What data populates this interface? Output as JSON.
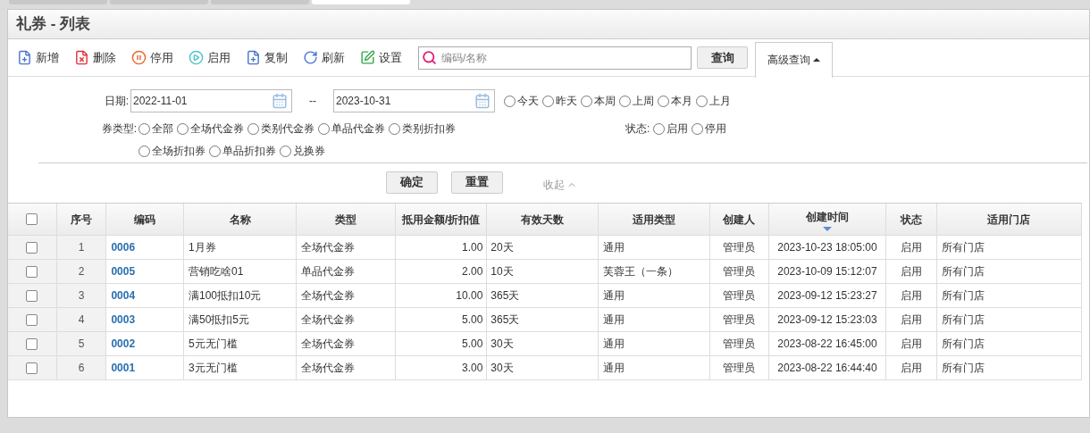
{
  "top_tabs": [
    {
      "selected": false
    },
    {
      "selected": false
    },
    {
      "selected": false
    },
    {
      "selected": true
    }
  ],
  "window": {
    "title": "礼券 - 列表"
  },
  "toolbar": [
    {
      "kind": "add",
      "label": "新增"
    },
    {
      "kind": "delete",
      "label": "删除"
    },
    {
      "kind": "pause",
      "label": "停用"
    },
    {
      "kind": "play",
      "label": "启用"
    },
    {
      "kind": "copy",
      "label": "复制"
    },
    {
      "kind": "refresh",
      "label": "刷新"
    },
    {
      "kind": "settings",
      "label": "设置"
    }
  ],
  "search": {
    "placeholder": "编码/名称",
    "button": "查询"
  },
  "advanced": {
    "label": "高级查询",
    "expanded": true
  },
  "filters": {
    "date_label": "日期:",
    "date_from": "2022-11-01",
    "date_sep": "--",
    "date_to": "2023-10-31",
    "date_presets": [
      {
        "label": "今天",
        "selected": false
      },
      {
        "label": "昨天",
        "selected": false
      },
      {
        "label": "本周",
        "selected": false
      },
      {
        "label": "上周",
        "selected": false
      },
      {
        "label": "本月",
        "selected": false
      },
      {
        "label": "上月",
        "selected": false
      }
    ],
    "type_label": "券类型:",
    "types": [
      {
        "label": "全部",
        "selected": false
      },
      {
        "label": "全场代金券",
        "selected": false
      },
      {
        "label": "类别代金券",
        "selected": false
      },
      {
        "label": "单品代金券",
        "selected": false
      },
      {
        "label": "类别折扣券",
        "selected": false
      },
      {
        "label": "全场折扣券",
        "selected": false
      },
      {
        "label": "单品折扣券",
        "selected": false
      },
      {
        "label": "兑换券",
        "selected": false
      }
    ],
    "status_label": "状态:",
    "statuses": [
      {
        "label": "启用",
        "selected": false
      },
      {
        "label": "停用",
        "selected": false
      }
    ],
    "confirm": "确定",
    "reset": "重置",
    "collapse": "收起"
  },
  "table": {
    "all_checked": false,
    "columns": [
      {
        "label": "序号",
        "sorted": false
      },
      {
        "label": "编码",
        "sorted": false
      },
      {
        "label": "名称",
        "sorted": false
      },
      {
        "label": "类型",
        "sorted": false
      },
      {
        "label": "抵用金额/折扣值",
        "sorted": false
      },
      {
        "label": "有效天数",
        "sorted": false
      },
      {
        "label": "适用类型",
        "sorted": false
      },
      {
        "label": "创建人",
        "sorted": false
      },
      {
        "label": "创建时间",
        "sorted": true
      },
      {
        "label": "状态",
        "sorted": false
      },
      {
        "label": "适用门店",
        "sorted": false
      }
    ],
    "rows": [
      {
        "checked": false,
        "cells": [
          "1",
          "0006",
          "1月券",
          "全场代金券",
          "1.00",
          "20天",
          "通用",
          "管理员",
          "2023-10-23 18:05:00",
          "启用",
          "所有门店"
        ]
      },
      {
        "checked": false,
        "cells": [
          "2",
          "0005",
          "营销吃啥01",
          "单品代金券",
          "2.00",
          "10天",
          "芙蓉王（一条）",
          "管理员",
          "2023-10-09 15:12:07",
          "启用",
          "所有门店"
        ]
      },
      {
        "checked": false,
        "cells": [
          "3",
          "0004",
          "满100抵扣10元",
          "全场代金券",
          "10.00",
          "365天",
          "通用",
          "管理员",
          "2023-09-12 15:23:27",
          "启用",
          "所有门店"
        ]
      },
      {
        "checked": false,
        "cells": [
          "4",
          "0003",
          "满50抵扣5元",
          "全场代金券",
          "5.00",
          "365天",
          "通用",
          "管理员",
          "2023-09-12 15:23:03",
          "启用",
          "所有门店"
        ]
      },
      {
        "checked": false,
        "cells": [
          "5",
          "0002",
          "5元无门槛",
          "全场代金券",
          "5.00",
          "30天",
          "通用",
          "管理员",
          "2023-08-22 16:45:00",
          "启用",
          "所有门店"
        ]
      },
      {
        "checked": false,
        "cells": [
          "6",
          "0001",
          "3元无门槛",
          "全场代金券",
          "3.00",
          "30天",
          "通用",
          "管理员",
          "2023-08-22 16:44:40",
          "启用",
          "所有门店"
        ]
      }
    ]
  }
}
